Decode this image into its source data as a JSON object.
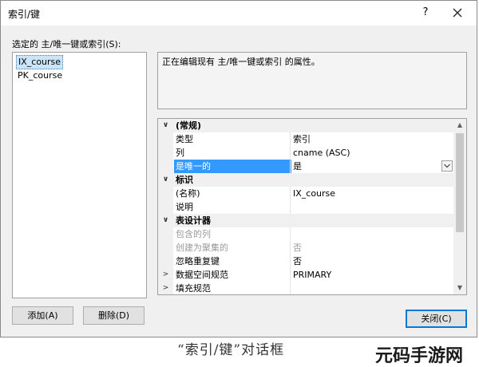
{
  "window": {
    "title": "索引/键",
    "help_label": "?"
  },
  "left": {
    "label": "选定的 主/唯一键或索引(S):",
    "items": [
      "IX_course",
      "PK_course"
    ]
  },
  "description": "正在编辑现有 主/唯一键或索引 的属性。",
  "grid": {
    "rows": [
      {
        "kind": "cat",
        "gutter": "∨",
        "name": "(常规)",
        "value": ""
      },
      {
        "kind": "prop",
        "gutter": "",
        "name": "类型",
        "value": "索引"
      },
      {
        "kind": "prop",
        "gutter": "",
        "name": "列",
        "value": "cname (ASC)"
      },
      {
        "kind": "hl",
        "gutter": "",
        "name": "是唯一的",
        "value": "是"
      },
      {
        "kind": "cat",
        "gutter": "∨",
        "name": "标识",
        "value": ""
      },
      {
        "kind": "prop",
        "gutter": "",
        "name": "(名称)",
        "value": "IX_course"
      },
      {
        "kind": "prop",
        "gutter": "",
        "name": "说明",
        "value": ""
      },
      {
        "kind": "cat",
        "gutter": "∨",
        "name": "表设计器",
        "value": ""
      },
      {
        "kind": "dis",
        "gutter": "",
        "name": "包含的列",
        "value": ""
      },
      {
        "kind": "dis",
        "gutter": "",
        "name": "创建为聚集的",
        "value": "否"
      },
      {
        "kind": "prop",
        "gutter": "",
        "name": "忽略重复键",
        "value": "否"
      },
      {
        "kind": "prop",
        "gutter": ">",
        "name": "数据空间规范",
        "value": "PRIMARY"
      },
      {
        "kind": "prop",
        "gutter": ">",
        "name": "填充规范",
        "value": ""
      }
    ]
  },
  "buttons": {
    "add": "添加(A)",
    "delete": "删除(D)",
    "close": "关闭(C)"
  },
  "caption": "“索引/键”对话框",
  "watermark": "元码手游网"
}
